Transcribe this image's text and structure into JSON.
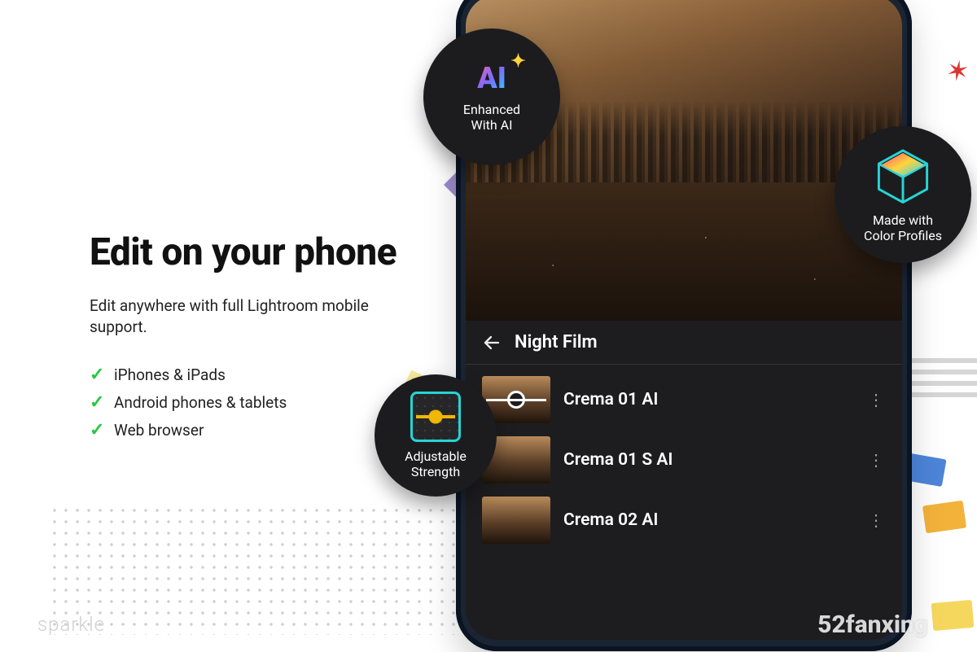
{
  "left": {
    "heading": "Edit on your phone",
    "subtitle": "Edit anywhere with full Lightroom mobile support.",
    "features": [
      "iPhones & iPads",
      "Android phones & tablets",
      "Web browser"
    ]
  },
  "phone": {
    "section_title": "Night Film",
    "presets": [
      {
        "label": "Crema 01 AI",
        "adjust": true
      },
      {
        "label": "Crema 01 S AI",
        "adjust": false
      },
      {
        "label": "Crema 02 AI",
        "adjust": false
      }
    ]
  },
  "badges": {
    "ai": {
      "glyph": "AI",
      "label_l1": "Enhanced",
      "label_l2": "With AI"
    },
    "profiles": {
      "label_l1": "Made with",
      "label_l2": "Color Profiles"
    },
    "strength": {
      "label_l1": "Adjustable",
      "label_l2": "Strength"
    }
  },
  "watermark": {
    "left": "sparkle",
    "right": "52fanxing"
  }
}
